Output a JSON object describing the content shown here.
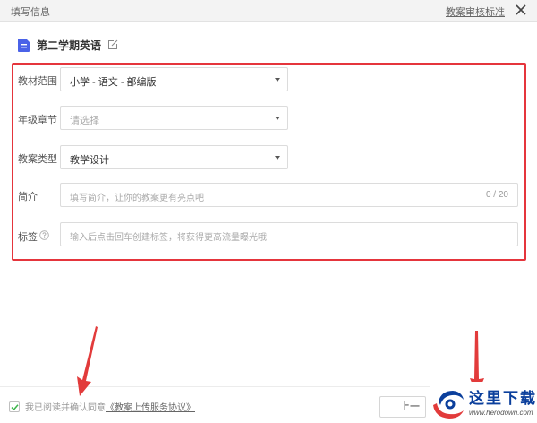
{
  "dialog": {
    "title": "填写信息",
    "standard_link": "教案审核标准"
  },
  "doc": {
    "title": "第二学期英语"
  },
  "form": {
    "textbook": {
      "label": "教材范围",
      "value": "小学 - 语文 - 部编版"
    },
    "chapter": {
      "label": "年级章节",
      "placeholder": "请选择"
    },
    "type": {
      "label": "教案类型",
      "value": "教学设计"
    },
    "intro": {
      "label": "简介",
      "placeholder": "填写简介，让你的教案更有亮点吧",
      "counter": "0 / 20"
    },
    "tags": {
      "label": "标签",
      "placeholder": "输入后点击回车创建标签，将获得更高流量曝光哦"
    }
  },
  "footer": {
    "agree_prefix": "我已阅读并确认同意",
    "agree_link": "《教案上传服务协议》",
    "prev_button": "上一"
  },
  "watermark": {
    "text": "这里下载",
    "url": "www.herodown.com"
  },
  "colors": {
    "highlight": "#e5353c",
    "accent": "#4a62e8",
    "arrow": "#e23b3b"
  }
}
